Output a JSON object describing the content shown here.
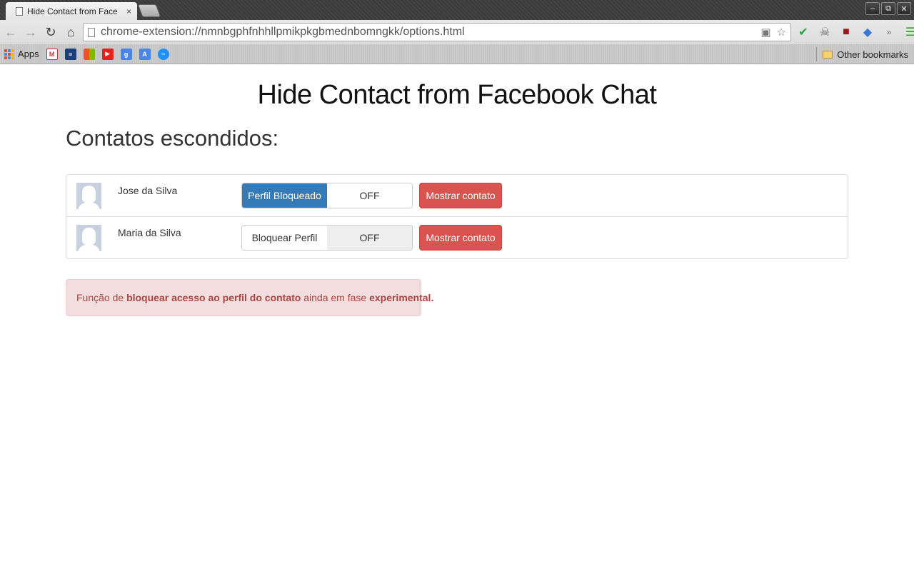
{
  "browser": {
    "tab_title": "Hide Contact from Face",
    "tab_close": "×",
    "url": "chrome-extension://nmnbgphfnhhllpmikpkgbmednbomngkk/options.html",
    "window_controls": [
      "–",
      "⧉",
      "✕"
    ]
  },
  "bookmarks": {
    "apps_label": "Apps",
    "other_label": "Other bookmarks",
    "icons": [
      "gmail-calendar-icon",
      "ieee-icon",
      "microsoft-icon",
      "youtube-icon",
      "google-plus-icon",
      "translate-icon",
      "messenger-icon"
    ]
  },
  "page": {
    "title": "Hide Contact from Facebook Chat",
    "section_title": "Contatos escondidos:",
    "contacts": [
      {
        "name": "Jose da Silva",
        "toggle_on_label": "Perfil Bloqueado",
        "toggle_off_label": "OFF",
        "blocked": true,
        "show_label": "Mostrar contato"
      },
      {
        "name": "Maria da Silva",
        "toggle_on_label": "Bloquear Perfil",
        "toggle_off_label": "OFF",
        "blocked": false,
        "show_label": "Mostrar contato"
      }
    ],
    "alert": {
      "prefix": "Função de ",
      "bold1": "bloquear acesso ao perfil do contato",
      "middle": " ainda em fase ",
      "bold2": "experimental."
    }
  },
  "colors": {
    "primary": "#337ab7",
    "danger": "#d9534f",
    "alert_bg": "#f2dede",
    "alert_text": "#a94442"
  }
}
